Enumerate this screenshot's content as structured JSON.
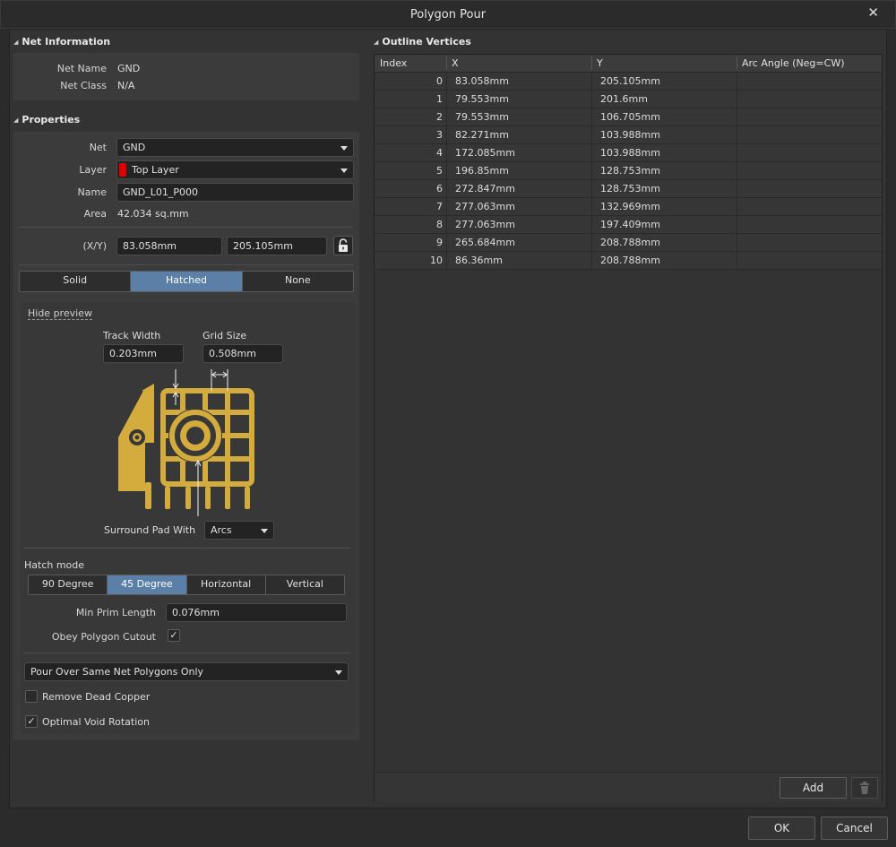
{
  "window": {
    "title": "Polygon Pour",
    "close_glyph": "✕"
  },
  "net_info": {
    "section_title": "Net Information",
    "net_name_label": "Net Name",
    "net_name_value": "GND",
    "net_class_label": "Net Class",
    "net_class_value": "N/A"
  },
  "properties": {
    "section_title": "Properties",
    "net_label": "Net",
    "net_value": "GND",
    "layer_label": "Layer",
    "layer_value": "Top Layer",
    "layer_color": "#e00000",
    "name_label": "Name",
    "name_value": "GND_L01_P000",
    "area_label": "Area",
    "area_value": "42.034 sq.mm",
    "xy_label": "(X/Y)",
    "x_value": "83.058mm",
    "y_value": "205.105mm",
    "lock_icon": "lock-icon"
  },
  "fill_modes": {
    "options": [
      "Solid",
      "Hatched",
      "None"
    ],
    "selected": "Hatched"
  },
  "preview": {
    "toggle_label": "Hide preview",
    "track_width_label": "Track Width",
    "track_width_value": "0.203mm",
    "grid_size_label": "Grid Size",
    "grid_size_value": "0.508mm",
    "copper_color": "#d4ac3e",
    "surround_label": "Surround Pad With",
    "surround_value": "Arcs"
  },
  "hatch": {
    "label": "Hatch mode",
    "options": [
      "90 Degree",
      "45 Degree",
      "Horizontal",
      "Vertical"
    ],
    "selected": "45 Degree",
    "min_prim_label": "Min Prim Length",
    "min_prim_value": "0.076mm",
    "obey_cutout_label": "Obey Polygon Cutout",
    "obey_cutout_checked": true
  },
  "pour": {
    "pour_over_value": "Pour Over Same Net Polygons Only",
    "remove_dead_label": "Remove Dead Copper",
    "remove_dead_checked": false,
    "optimal_void_label": "Optimal Void Rotation",
    "optimal_void_checked": true
  },
  "vertices": {
    "section_title": "Outline Vertices",
    "columns": [
      "Index",
      "X",
      "Y",
      "Arc Angle (Neg=CW)"
    ],
    "rows": [
      [
        "0",
        "83.058mm",
        "205.105mm",
        ""
      ],
      [
        "1",
        "79.553mm",
        "201.6mm",
        ""
      ],
      [
        "2",
        "79.553mm",
        "106.705mm",
        ""
      ],
      [
        "3",
        "82.271mm",
        "103.988mm",
        ""
      ],
      [
        "4",
        "172.085mm",
        "103.988mm",
        ""
      ],
      [
        "5",
        "196.85mm",
        "128.753mm",
        ""
      ],
      [
        "6",
        "272.847mm",
        "128.753mm",
        ""
      ],
      [
        "7",
        "277.063mm",
        "132.969mm",
        ""
      ],
      [
        "8",
        "277.063mm",
        "197.409mm",
        ""
      ],
      [
        "9",
        "265.684mm",
        "208.788mm",
        ""
      ],
      [
        "10",
        "86.36mm",
        "208.788mm",
        ""
      ]
    ],
    "add_label": "Add",
    "delete_icon": "trash-icon"
  },
  "footer": {
    "ok_label": "OK",
    "cancel_label": "Cancel"
  },
  "colors": {
    "accent": "#5b7fa6",
    "background": "#333333"
  }
}
